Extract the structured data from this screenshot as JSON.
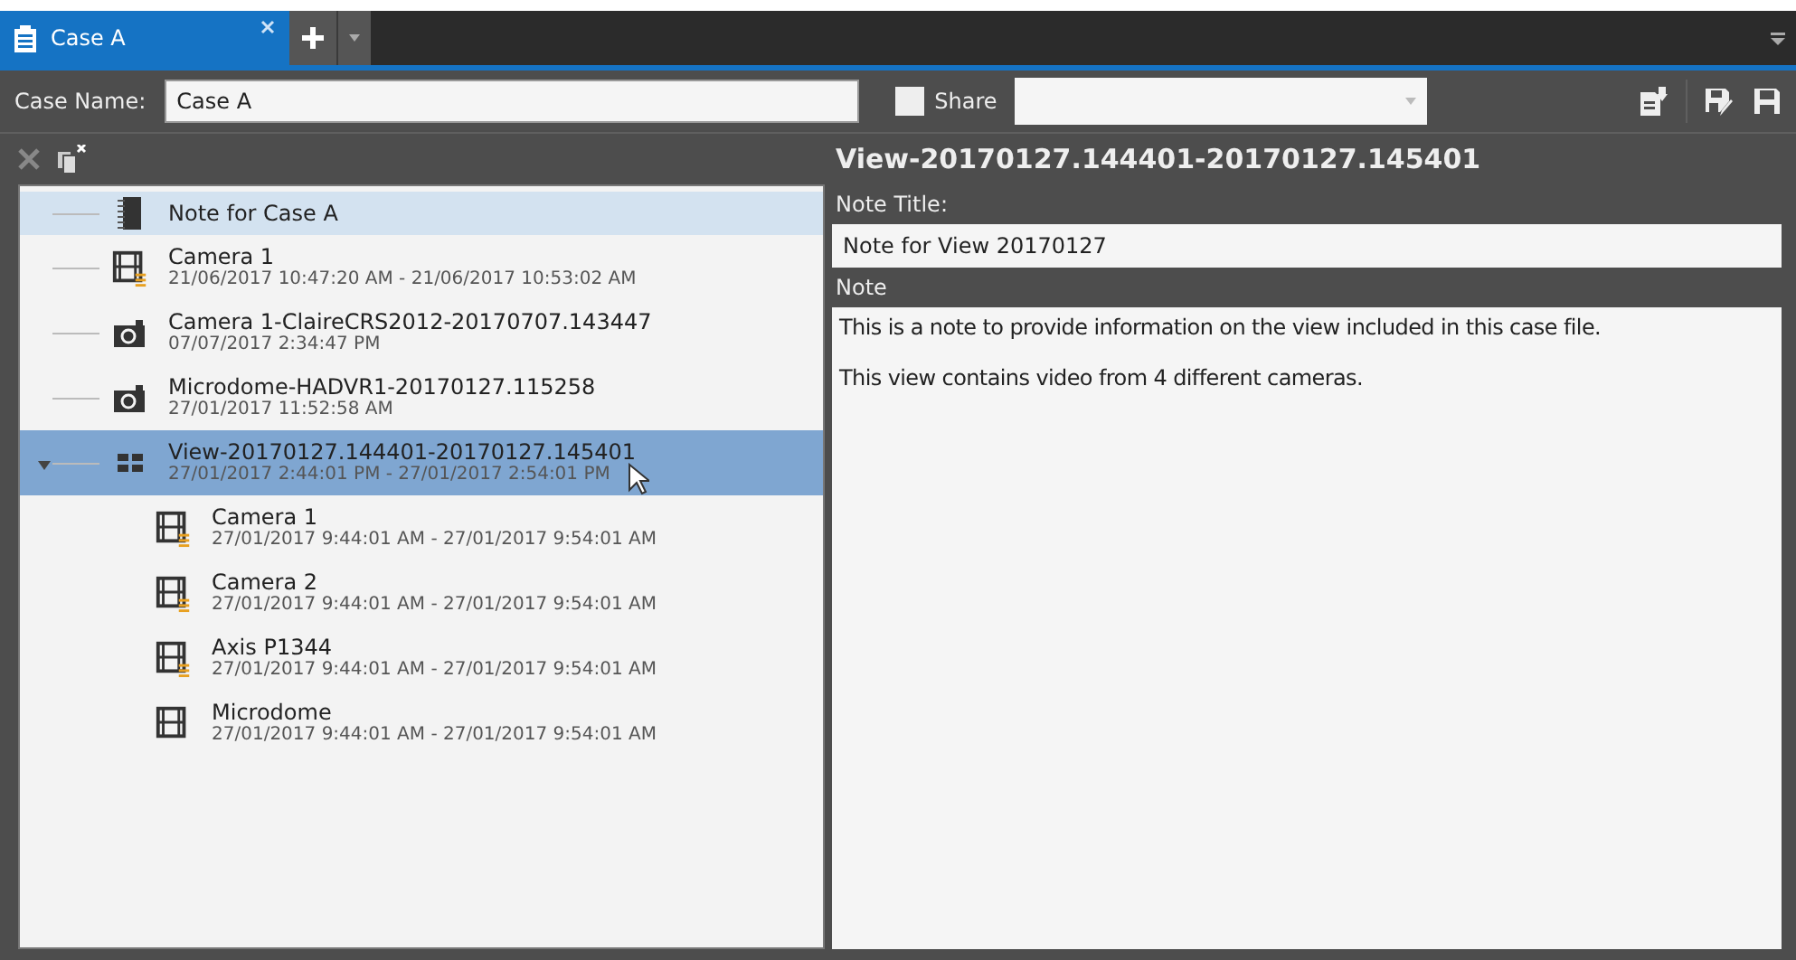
{
  "tabs": [
    {
      "label": "Case A",
      "selected": true
    }
  ],
  "case_name": {
    "label": "Case Name:",
    "value": "Case A"
  },
  "share": {
    "label": "Share",
    "checked": false
  },
  "tree": [
    {
      "kind": "note",
      "title": "Note for Case A",
      "selected": false,
      "highlighted": true
    },
    {
      "kind": "clip",
      "title": "Camera 1",
      "subtitle": "21/06/2017 10:47:20 AM - 21/06/2017 10:53:02 AM",
      "marked": true,
      "selected": false
    },
    {
      "kind": "snapshot",
      "title": "Camera 1-ClaireCRS2012-20170707.143447",
      "subtitle": "07/07/2017 2:34:47 PM",
      "selected": false
    },
    {
      "kind": "snapshot",
      "title": "Microdome-HADVR1-20170127.115258",
      "subtitle": "27/01/2017 11:52:58 AM",
      "selected": false
    },
    {
      "kind": "view",
      "title": "View-20170127.144401-20170127.145401",
      "subtitle": "27/01/2017 2:44:01 PM - 27/01/2017 2:54:01 PM",
      "selected": true,
      "expanded": true,
      "children": [
        {
          "kind": "clip",
          "title": "Camera 1",
          "subtitle": "27/01/2017 9:44:01 AM - 27/01/2017 9:54:01 AM",
          "marked": true,
          "selected": false
        },
        {
          "kind": "clip",
          "title": "Camera 2",
          "subtitle": "27/01/2017 9:44:01 AM - 27/01/2017 9:54:01 AM",
          "marked": true,
          "selected": false
        },
        {
          "kind": "clip",
          "title": "Axis P1344",
          "subtitle": "27/01/2017 9:44:01 AM - 27/01/2017 9:54:01 AM",
          "marked": true,
          "selected": false
        },
        {
          "kind": "clip",
          "title": "Microdome",
          "subtitle": "27/01/2017 9:44:01 AM - 27/01/2017 9:54:01 AM",
          "marked": false,
          "selected": false
        }
      ]
    }
  ],
  "detail": {
    "heading": "View-20170127.144401-20170127.145401",
    "title_label": "Note Title:",
    "title_value": "Note for View 20170127",
    "note_label": "Note",
    "note_paragraphs": [
      "This is a note to provide information on the view included in this case file.",
      "This view contains video from 4 different cameras."
    ]
  }
}
